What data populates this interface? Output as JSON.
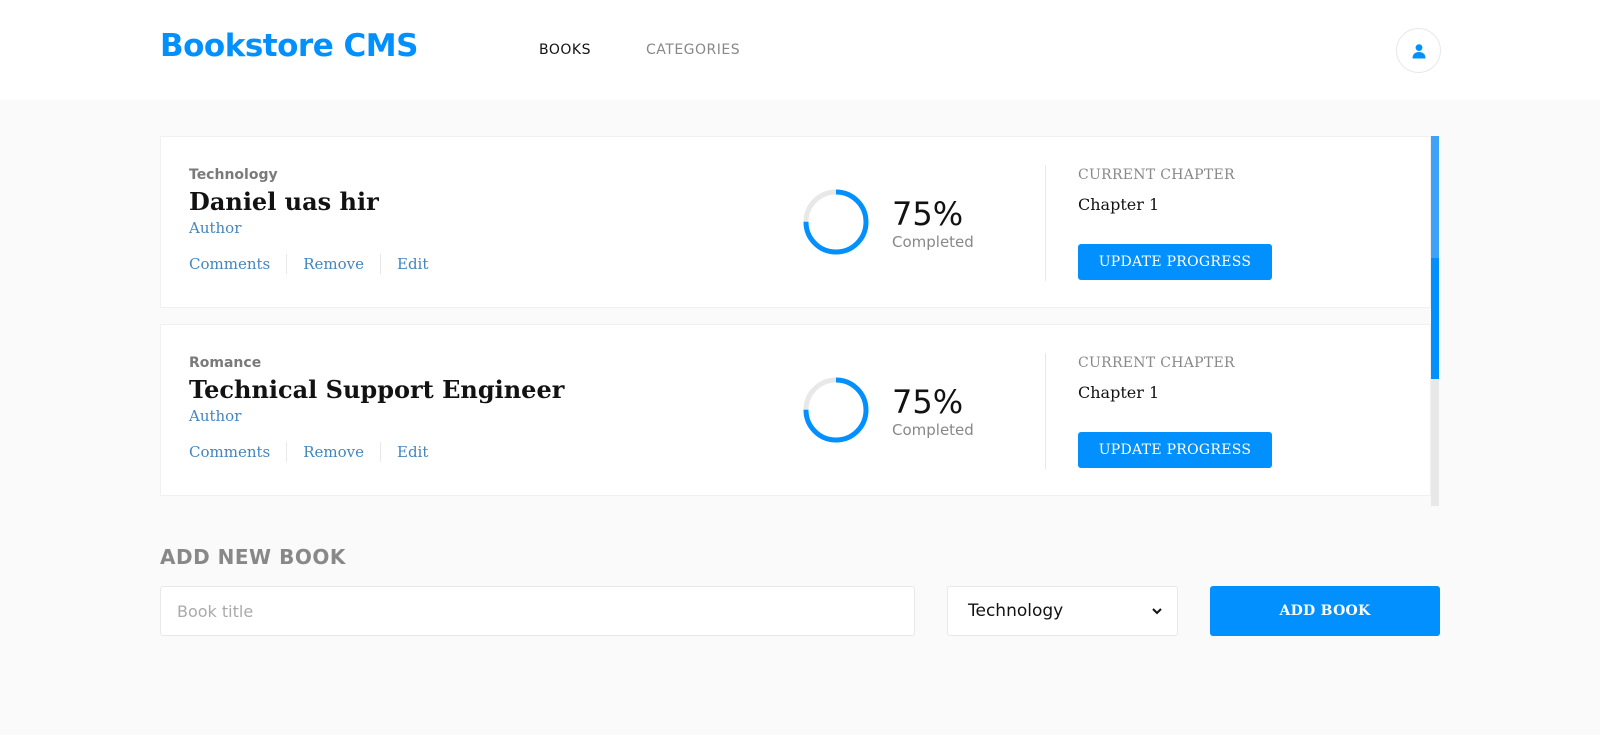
{
  "header": {
    "brand": "Bookstore CMS",
    "nav": [
      {
        "label": "BOOKS"
      },
      {
        "label": "CATEGORIES"
      }
    ],
    "user_icon": "user-icon"
  },
  "colors": {
    "accent": "#0290ff",
    "link": "#4386bf",
    "muted": "#888888",
    "background": "#fafafa"
  },
  "books": [
    {
      "category": "Technology",
      "title": "Daniel uas hir",
      "author": "Author",
      "actions": [
        "Comments",
        "Remove",
        "Edit"
      ],
      "progress_percent": 75,
      "percent_label": "75%",
      "completed_label": "Completed",
      "chapter_label": "CURRENT CHAPTER",
      "chapter": "Chapter 1",
      "update_label": "UPDATE PROGRESS"
    },
    {
      "category": "Romance",
      "title": "Technical Support Engineer",
      "author": "Author",
      "actions": [
        "Comments",
        "Remove",
        "Edit"
      ],
      "progress_percent": 75,
      "percent_label": "75%",
      "completed_label": "Completed",
      "chapter_label": "CURRENT CHAPTER",
      "chapter": "Chapter 1",
      "update_label": "UPDATE PROGRESS"
    }
  ],
  "add_form": {
    "heading": "ADD NEW BOOK",
    "title_placeholder": "Book title",
    "title_value": "",
    "category_selected": "Technology",
    "submit_label": "ADD BOOK"
  }
}
